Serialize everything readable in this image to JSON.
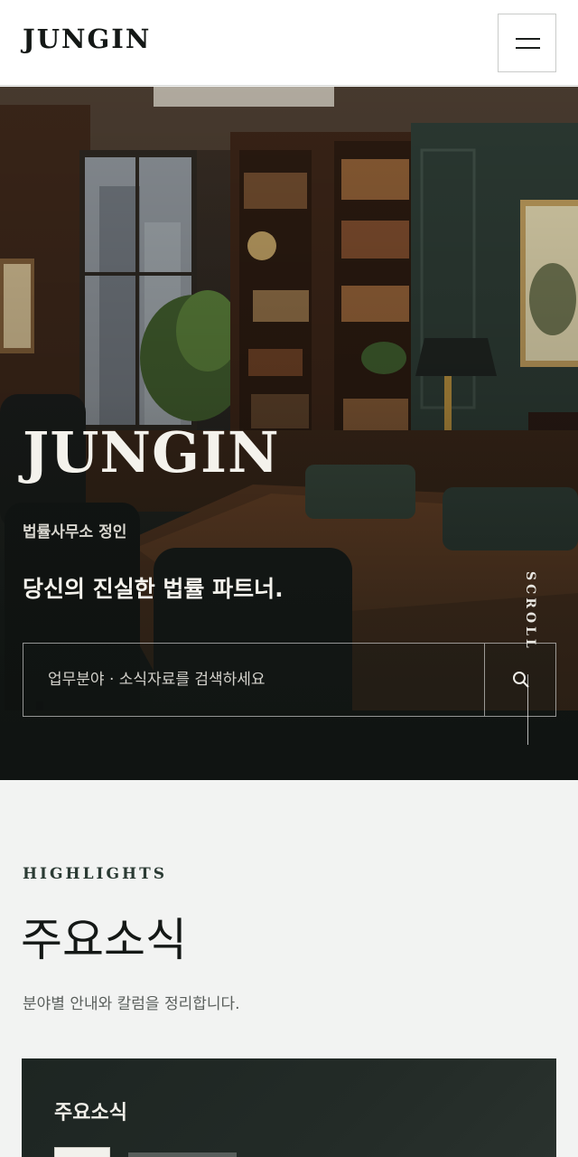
{
  "header": {
    "logo": "JUNGIN",
    "menu_icon": "hamburger-menu-icon"
  },
  "hero": {
    "title": "JUNGIN",
    "subtitle": "법률사무소 정인",
    "tagline": "당신의 진실한 법률 파트너.",
    "search": {
      "placeholder": "업무분야 · 소식자료를 검색하세요",
      "value": "",
      "icon": "search-icon"
    },
    "scroll_label": "SCROLL"
  },
  "highlights": {
    "kicker": "HIGHLIGHTS",
    "title": "주요소식",
    "description": "분야별 안내와 칼럼을 정리합니다.",
    "card": {
      "title": "주요소식"
    }
  },
  "colors": {
    "header_bg": "#ffffff",
    "hero_text": "#f4f2ec",
    "section_bg": "#f2f3f2",
    "card_bg": "#1d2522",
    "accent_green": "#2a3a33"
  }
}
